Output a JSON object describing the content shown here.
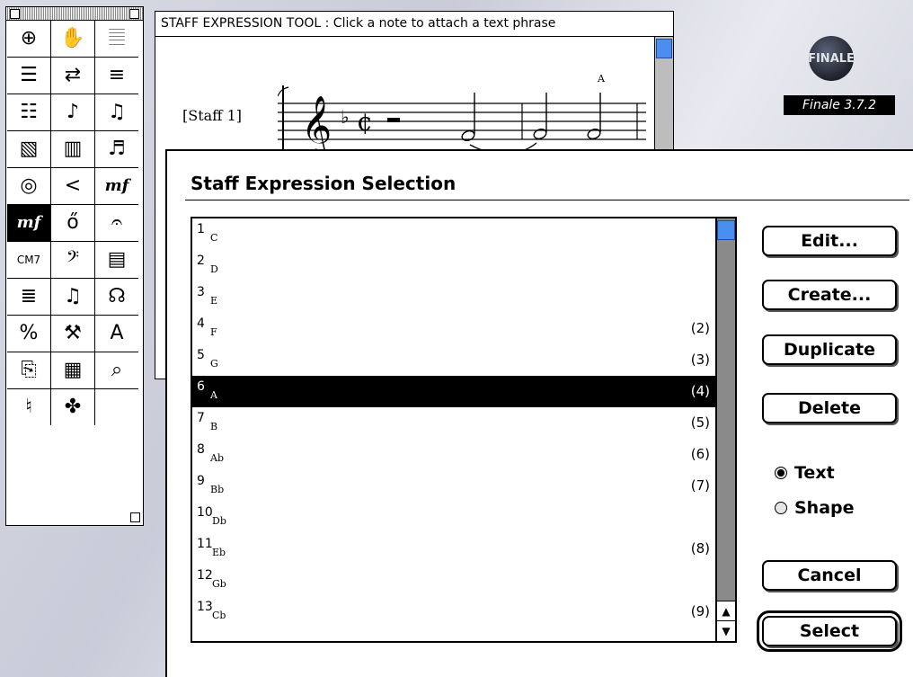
{
  "staff_window": {
    "message": "STAFF EXPRESSION TOOL : Click a note to attach a text phrase",
    "staff_label": "[Staff 1]",
    "expression_marker": "A"
  },
  "branding": {
    "logo_text": "FINALE",
    "version": "Finale 3.7.2"
  },
  "palette": {
    "tools": [
      {
        "icon": "zoom-icon",
        "glyph": "⊕"
      },
      {
        "icon": "hand-icon",
        "glyph": "✋"
      },
      {
        "icon": "staff-icon",
        "glyph": "𝄚"
      },
      {
        "icon": "measure-icon",
        "glyph": "☰"
      },
      {
        "icon": "resize-icon",
        "glyph": "⇄"
      },
      {
        "icon": "mass-edit-icon",
        "glyph": "≡"
      },
      {
        "icon": "page-layout-icon",
        "glyph": "☷"
      },
      {
        "icon": "note-icon",
        "glyph": "♪"
      },
      {
        "icon": "tuplet-icon",
        "glyph": "♫"
      },
      {
        "icon": "key-signature-icon",
        "glyph": "▧"
      },
      {
        "icon": "keyboard-icon",
        "glyph": "▥"
      },
      {
        "icon": "chord-icon",
        "glyph": "♬"
      },
      {
        "icon": "midi-icon",
        "glyph": "◎"
      },
      {
        "icon": "hairpin-icon",
        "glyph": "<"
      },
      {
        "icon": "expression-icon",
        "glyph": "mf"
      },
      {
        "icon": "staff-expression-icon",
        "glyph": "mf"
      },
      {
        "icon": "articulation-icon",
        "glyph": "ő"
      },
      {
        "icon": "smart-shape-icon",
        "glyph": "𝄐"
      },
      {
        "icon": "chord-symbol-icon",
        "glyph": "CM7"
      },
      {
        "icon": "clef-icon",
        "glyph": "𝄢"
      },
      {
        "icon": "repeat-icon",
        "glyph": "▤"
      },
      {
        "icon": "time-signature-icon",
        "glyph": "≣"
      },
      {
        "icon": "special-tools-icon",
        "glyph": "♫"
      },
      {
        "icon": "lyrics-icon",
        "glyph": "☊"
      },
      {
        "icon": "percent-icon",
        "glyph": "%"
      },
      {
        "icon": "tools-icon",
        "glyph": "⚒"
      },
      {
        "icon": "text-icon",
        "glyph": "A"
      },
      {
        "icon": "page-icon",
        "glyph": "⎘"
      },
      {
        "icon": "graphics-icon",
        "glyph": "▦"
      },
      {
        "icon": "selection-icon",
        "glyph": "⌕"
      },
      {
        "icon": "speedy-entry-icon",
        "glyph": "♮"
      },
      {
        "icon": "hyperscribe-icon",
        "glyph": "✤"
      }
    ],
    "selected_index": 15
  },
  "dialog": {
    "title": "Staff Expression Selection",
    "items": [
      {
        "num": "1",
        "name": "C",
        "count": ""
      },
      {
        "num": "2",
        "name": "D",
        "count": ""
      },
      {
        "num": "3",
        "name": "E",
        "count": ""
      },
      {
        "num": "4",
        "name": "F",
        "count": "(2)"
      },
      {
        "num": "5",
        "name": "G",
        "count": "(3)"
      },
      {
        "num": "6",
        "name": "A",
        "count": "(4)"
      },
      {
        "num": "7",
        "name": "B",
        "count": "(5)"
      },
      {
        "num": "8",
        "name": "Ab",
        "count": "(6)"
      },
      {
        "num": "9",
        "name": "Bb",
        "count": "(7)"
      },
      {
        "num": "10",
        "name": "Db",
        "count": ""
      },
      {
        "num": "11",
        "name": "Eb",
        "count": "(8)"
      },
      {
        "num": "12",
        "name": "Gb",
        "count": ""
      },
      {
        "num": "13",
        "name": "Cb",
        "count": "(9)"
      }
    ],
    "selected_item": 5,
    "buttons": {
      "edit": "Edit...",
      "create": "Create...",
      "duplicate": "Duplicate",
      "delete": "Delete",
      "cancel": "Cancel",
      "select": "Select"
    },
    "radio": {
      "text": "Text",
      "shape": "Shape",
      "selected": "text"
    }
  },
  "colors": {
    "scroll_thumb": "#4a8ff0",
    "selection": "#000000"
  }
}
